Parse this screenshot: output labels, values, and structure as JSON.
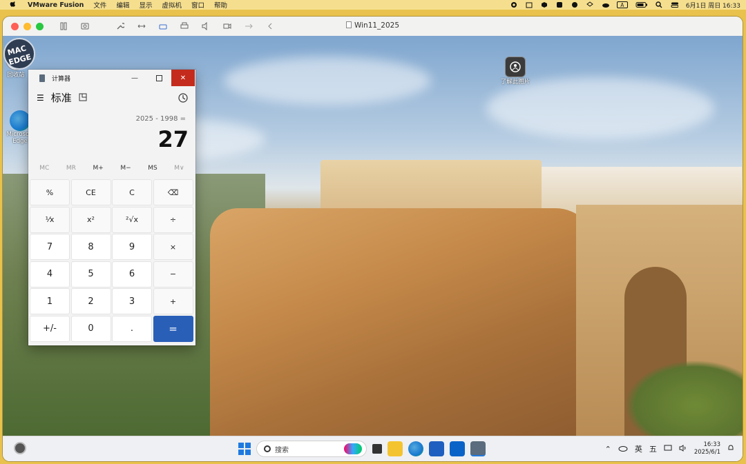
{
  "menubar": {
    "app_name": "VMware Fusion",
    "items": [
      "文件",
      "编辑",
      "显示",
      "虚拟机",
      "窗口",
      "帮助"
    ],
    "input_badge": "A",
    "datetime": "6月1日 周日  16:33"
  },
  "vm_window": {
    "title": "Win11_2025"
  },
  "desktop": {
    "icons": [
      {
        "label": "回收站"
      },
      {
        "label": "Microsoft Edge"
      },
      {
        "label": "了解此图片"
      }
    ]
  },
  "watermark": {
    "text": "MAC EDGE"
  },
  "calculator": {
    "title": "计算器",
    "mode": "标准",
    "expression": "2025 - 1998 =",
    "result": "27",
    "memory": [
      "MC",
      "MR",
      "M+",
      "M−",
      "MS",
      "M∨"
    ],
    "memory_disabled": [
      true,
      true,
      false,
      false,
      false,
      true
    ],
    "keys": [
      [
        "%",
        "CE",
        "C",
        "⌫"
      ],
      [
        "¹⁄x",
        "x²",
        "²√x",
        "÷"
      ],
      [
        "7",
        "8",
        "9",
        "×"
      ],
      [
        "4",
        "5",
        "6",
        "−"
      ],
      [
        "1",
        "2",
        "3",
        "+"
      ],
      [
        "+/-",
        "0",
        ".",
        "="
      ]
    ]
  },
  "taskbar": {
    "search_placeholder": "搜索",
    "tray": {
      "ime_lang": "英",
      "ime_mode": "五",
      "time": "16:33",
      "date": "2025/6/1"
    }
  }
}
